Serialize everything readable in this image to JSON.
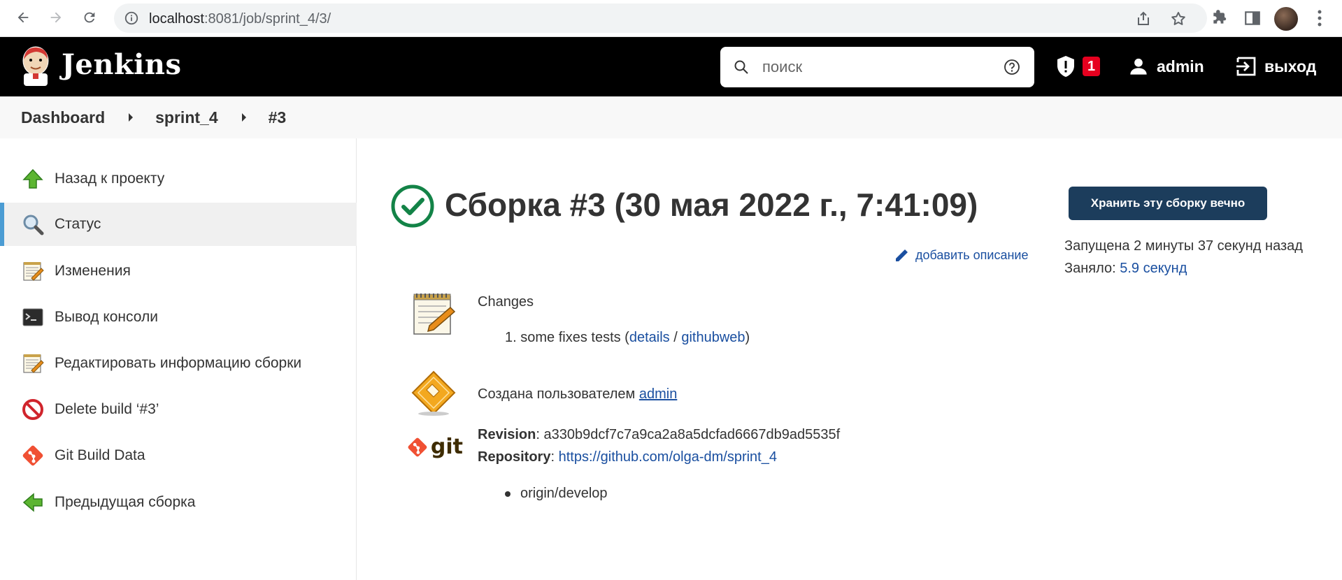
{
  "browser": {
    "url_host": "localhost",
    "url_path": ":8081/job/sprint_4/3/"
  },
  "header": {
    "title": "Jenkins",
    "search_placeholder": "поиск",
    "security_count": "1",
    "user": "admin",
    "logout": "выход"
  },
  "breadcrumb": [
    "Dashboard",
    "sprint_4",
    "#3"
  ],
  "sidebar": {
    "items": [
      {
        "label": "Назад к проекту",
        "icon": "up-arrow-icon"
      },
      {
        "label": "Статус",
        "icon": "magnifier-icon"
      },
      {
        "label": "Изменения",
        "icon": "notepad-icon"
      },
      {
        "label": "Вывод консоли",
        "icon": "terminal-icon"
      },
      {
        "label": "Редактировать информацию сборки",
        "icon": "notepad-icon"
      },
      {
        "label": "Delete build ‘#3’",
        "icon": "no-entry-icon"
      },
      {
        "label": "Git Build Data",
        "icon": "git-icon"
      },
      {
        "label": "Предыдущая сборка",
        "icon": "left-arrow-icon"
      }
    ]
  },
  "main": {
    "title": "Сборка #3 (30 мая 2022 г., 7:41:09)",
    "keep_button": "Хранить эту сборку вечно",
    "started": "Запущена 2 минуты 37 секунд назад",
    "took_label": "Заняло: ",
    "took_value": "5.9 секунд",
    "add_description": "добавить описание",
    "changes_label": "Changes",
    "change": {
      "number": "1.",
      "text": "some fixes tests (",
      "details": "details",
      "sep": " / ",
      "githubweb": "githubweb",
      "close": ")"
    },
    "created_by_label": "Создана пользователем ",
    "created_by_user": "admin",
    "revision_label": "Revision",
    "revision_value": ": a330b9dcf7c7a9ca2a8a5dcfad6667db9ad5535f",
    "repository_label": "Repository",
    "repository_sep": ": ",
    "repository_url": "https://github.com/olga-dm/sprint_4",
    "branch": "origin/develop",
    "git_logo_text": "git"
  },
  "colors": {
    "header_bg": "#000000",
    "link": "#1a4fa0",
    "keep_button_bg": "#1c3d5c",
    "success": "#138347",
    "badge": "#e6001f",
    "active_bar": "#4b9cd3"
  }
}
